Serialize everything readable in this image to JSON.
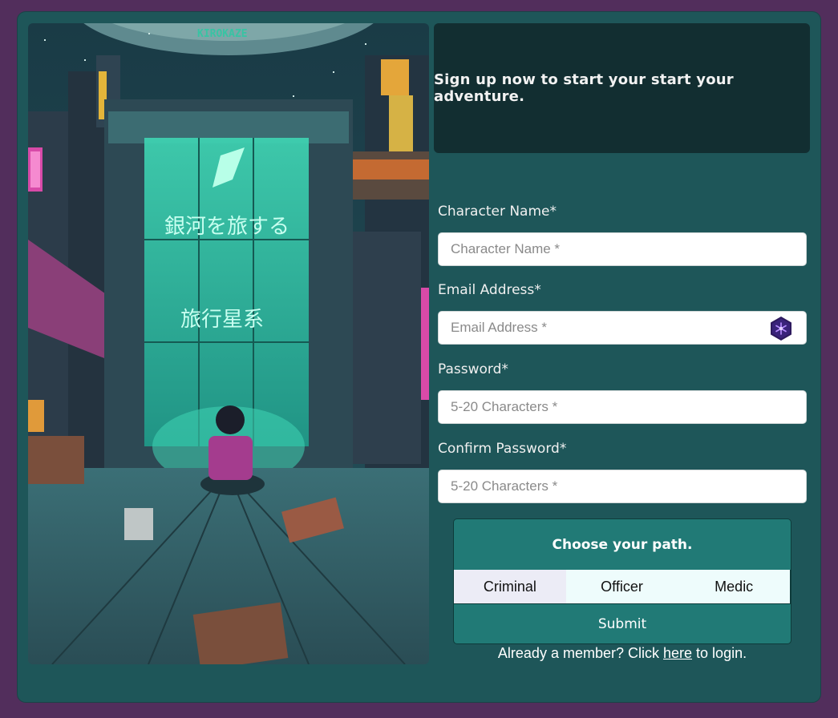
{
  "art": {
    "sign_text": "KIROKAZE"
  },
  "banner": {
    "text": "Sign up now to start your start your adventure."
  },
  "form": {
    "character_name": {
      "label": "Character Name*",
      "placeholder": "Character Name *",
      "value": ""
    },
    "email": {
      "label": "Email Address*",
      "placeholder": "Email Address *",
      "value": "",
      "icon": "password-manager-icon"
    },
    "password": {
      "label": "Password*",
      "placeholder": "5-20 Characters *",
      "value": ""
    },
    "confirm_password": {
      "label": "Confirm Password*",
      "placeholder": "5-20 Characters *",
      "value": ""
    }
  },
  "path": {
    "heading": "Choose your path.",
    "options": [
      "Criminal",
      "Officer",
      "Medic"
    ],
    "selected": "Criminal"
  },
  "submit_label": "Submit",
  "login": {
    "prefix": "Already a member? Click",
    "link": "here",
    "suffix": "to login."
  },
  "colors": {
    "page": "#522e5c",
    "card": "#1e5659",
    "banner": "#122e31",
    "accent": "#217a76"
  }
}
